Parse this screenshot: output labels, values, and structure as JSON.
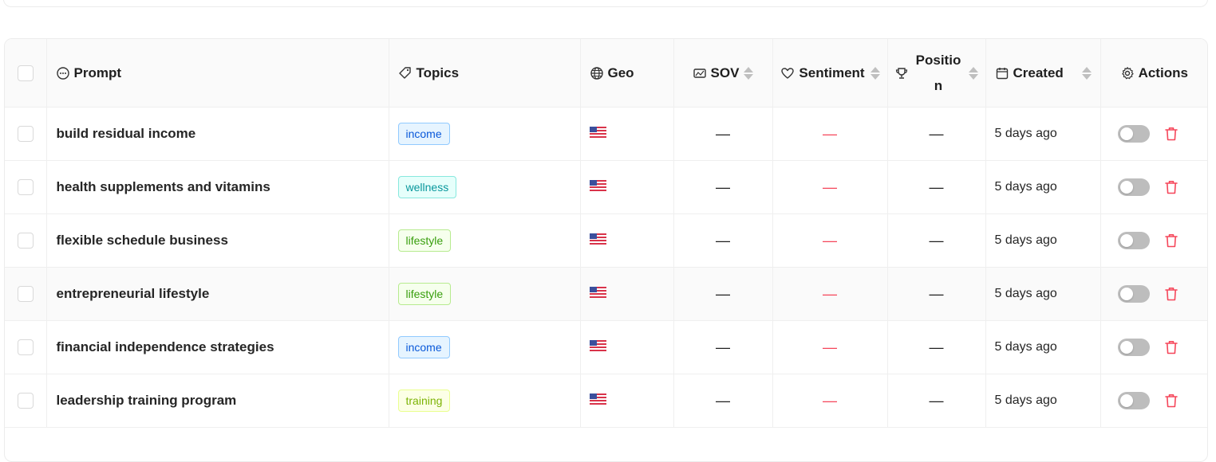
{
  "header": {
    "prompt": "Prompt",
    "topics": "Topics",
    "geo": "Geo",
    "sov": "SOV",
    "sentiment": "Sentiment",
    "position": "Position",
    "created": "Created",
    "actions": "Actions"
  },
  "colors": {
    "income": {
      "bg": "#e6f4ff",
      "border": "#91caff",
      "text": "#0958d9"
    },
    "wellness": {
      "bg": "#e6fffb",
      "border": "#87e8de",
      "text": "#08979c"
    },
    "lifestyle": {
      "bg": "#f6ffed",
      "border": "#b7eb8f",
      "text": "#389e0d"
    },
    "training": {
      "bg": "#fcffe6",
      "border": "#eaff8f",
      "text": "#7cb305"
    },
    "danger": "#f5465a"
  },
  "rows": [
    {
      "prompt": "build residual income",
      "topic": "income",
      "geo": "us-flag-icon",
      "sov": "—",
      "sentiment": "—",
      "position": "—",
      "created": "5 days ago"
    },
    {
      "prompt": "health supplements and vitamins",
      "topic": "wellness",
      "geo": "us-flag-icon",
      "sov": "—",
      "sentiment": "—",
      "position": "—",
      "created": "5 days ago"
    },
    {
      "prompt": "flexible schedule business",
      "topic": "lifestyle",
      "geo": "us-flag-icon",
      "sov": "—",
      "sentiment": "—",
      "position": "—",
      "created": "5 days ago"
    },
    {
      "prompt": "entrepreneurial lifestyle",
      "topic": "lifestyle",
      "geo": "us-flag-icon",
      "sov": "—",
      "sentiment": "—",
      "position": "—",
      "created": "5 days ago"
    },
    {
      "prompt": "financial independence strategies",
      "topic": "income",
      "geo": "us-flag-icon",
      "sov": "—",
      "sentiment": "—",
      "position": "—",
      "created": "5 days ago"
    },
    {
      "prompt": "leadership training program",
      "topic": "training",
      "geo": "us-flag-icon",
      "sov": "—",
      "sentiment": "—",
      "position": "—",
      "created": "5 days ago"
    }
  ]
}
